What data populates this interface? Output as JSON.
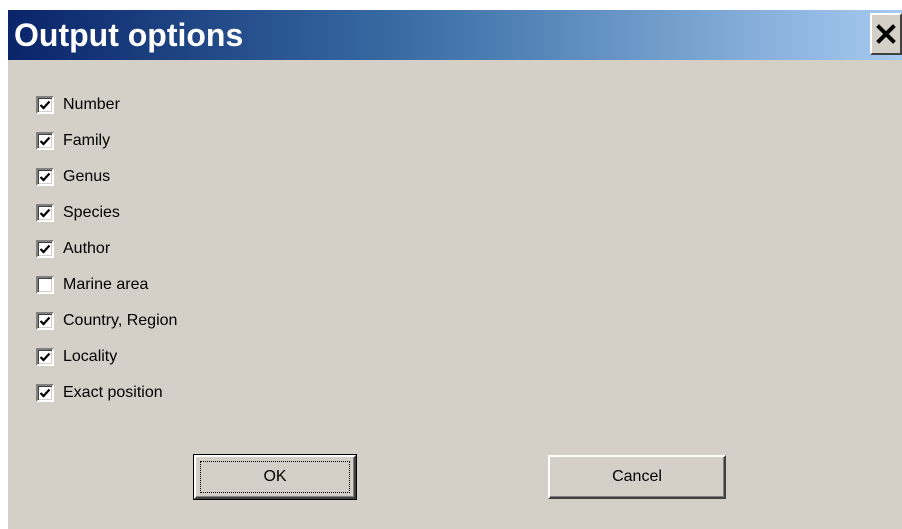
{
  "dialog": {
    "title": "Output options",
    "close_icon": "close-icon"
  },
  "options": [
    {
      "label": "Number",
      "checked": true
    },
    {
      "label": "Family",
      "checked": true
    },
    {
      "label": "Genus",
      "checked": true
    },
    {
      "label": "Species",
      "checked": true
    },
    {
      "label": "Author",
      "checked": true
    },
    {
      "label": "Marine area",
      "checked": false
    },
    {
      "label": "Country, Region",
      "checked": true
    },
    {
      "label": "Locality",
      "checked": true
    },
    {
      "label": "Exact position",
      "checked": true
    }
  ],
  "buttons": {
    "ok_label": "OK",
    "cancel_label": "Cancel"
  },
  "colors": {
    "face": "#d4d0c8",
    "title_gradient_start": "#0a246a",
    "title_gradient_end": "#a6caf0",
    "title_text": "#ffffff"
  }
}
